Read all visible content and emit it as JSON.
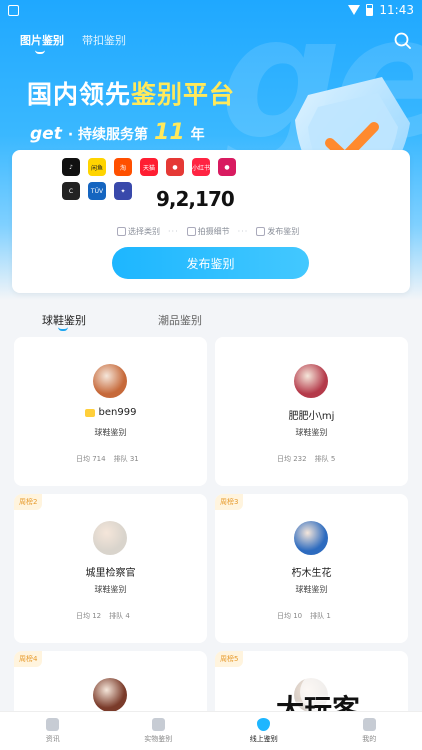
{
  "status": {
    "time": "11:43"
  },
  "top_tabs": [
    {
      "label": "图片鉴别"
    },
    {
      "label": "带扣鉴别"
    }
  ],
  "hero": {
    "title_a": "国内领先",
    "title_b": "鉴别平台",
    "brand": "get",
    "subtitle_a": "· 持续服务第",
    "years": "11",
    "subtitle_b": "年",
    "watermark_text": "get"
  },
  "platform_logos": {
    "row1": [
      {
        "name": "tiktok-icon",
        "color": "#111111",
        "text": "♪"
      },
      {
        "name": "xianyu-logo",
        "color": "#ffd400",
        "text": "闲鱼"
      },
      {
        "name": "taobao-logo",
        "color": "#ff5000",
        "text": "淘"
      },
      {
        "name": "tmall-logo",
        "color": "#ff1e32",
        "text": "天猫"
      },
      {
        "name": "app-logo-red",
        "color": "#e53935",
        "text": "●"
      },
      {
        "name": "xiaohongshu-logo",
        "color": "#ff2442",
        "text": "小红书"
      },
      {
        "name": "app-logo-pink",
        "color": "#d81b60",
        "text": "●"
      }
    ],
    "row2": [
      {
        "name": "c-logo",
        "color": "#222222",
        "text": "C"
      },
      {
        "name": "tuv-logo",
        "color": "#1565c0",
        "text": "TÜV"
      },
      {
        "name": "app-logo-blue",
        "color": "#3949ab",
        "text": "✦"
      }
    ]
  },
  "stat_value": "9,2,170",
  "steps": [
    {
      "label": "选择类别",
      "icon": "list-icon"
    },
    {
      "label": "拍摄细节",
      "icon": "camera-icon"
    },
    {
      "label": "发布鉴别",
      "icon": "upload-icon"
    }
  ],
  "publish_button": "发布鉴别",
  "categories": [
    {
      "label": "球鞋鉴别"
    },
    {
      "label": "潮品鉴别"
    }
  ],
  "appraisers": [
    {
      "rank": "",
      "name": "ben999",
      "vip": true,
      "type": "球鞋鉴别",
      "daily": "日均 714",
      "queue": "排队 31",
      "avatar_color": "#c6693a"
    },
    {
      "rank": "",
      "name": "肥肥小\\mj",
      "vip": false,
      "type": "球鞋鉴别",
      "daily": "日均 232",
      "queue": "排队 5",
      "avatar_color": "#b43a4a"
    },
    {
      "rank": "周榜2",
      "name": "城里检察官",
      "vip": false,
      "type": "球鞋鉴别",
      "daily": "日均 12",
      "queue": "排队 4",
      "avatar_color": "#d9d4cc"
    },
    {
      "rank": "周榜3",
      "name": "朽木生花",
      "vip": false,
      "type": "球鞋鉴别",
      "daily": "日均 10",
      "queue": "排队 1",
      "avatar_color": "#2d6bbf"
    },
    {
      "rank": "周榜4",
      "name": "",
      "vip": false,
      "type": "",
      "daily": "",
      "queue": "",
      "avatar_color": "#7a3b2a"
    },
    {
      "rank": "周榜5",
      "name": "",
      "vip": false,
      "type": "",
      "daily": "",
      "queue": "",
      "avatar_color": "#cfc7c0"
    }
  ],
  "bottom_nav": [
    {
      "label": "资讯",
      "icon": "news-icon"
    },
    {
      "label": "实物鉴别",
      "icon": "bag-icon"
    },
    {
      "label": "线上鉴别",
      "icon": "shield-icon"
    },
    {
      "label": "我的",
      "icon": "profile-icon"
    }
  ],
  "overlay_watermark": "大玩客"
}
